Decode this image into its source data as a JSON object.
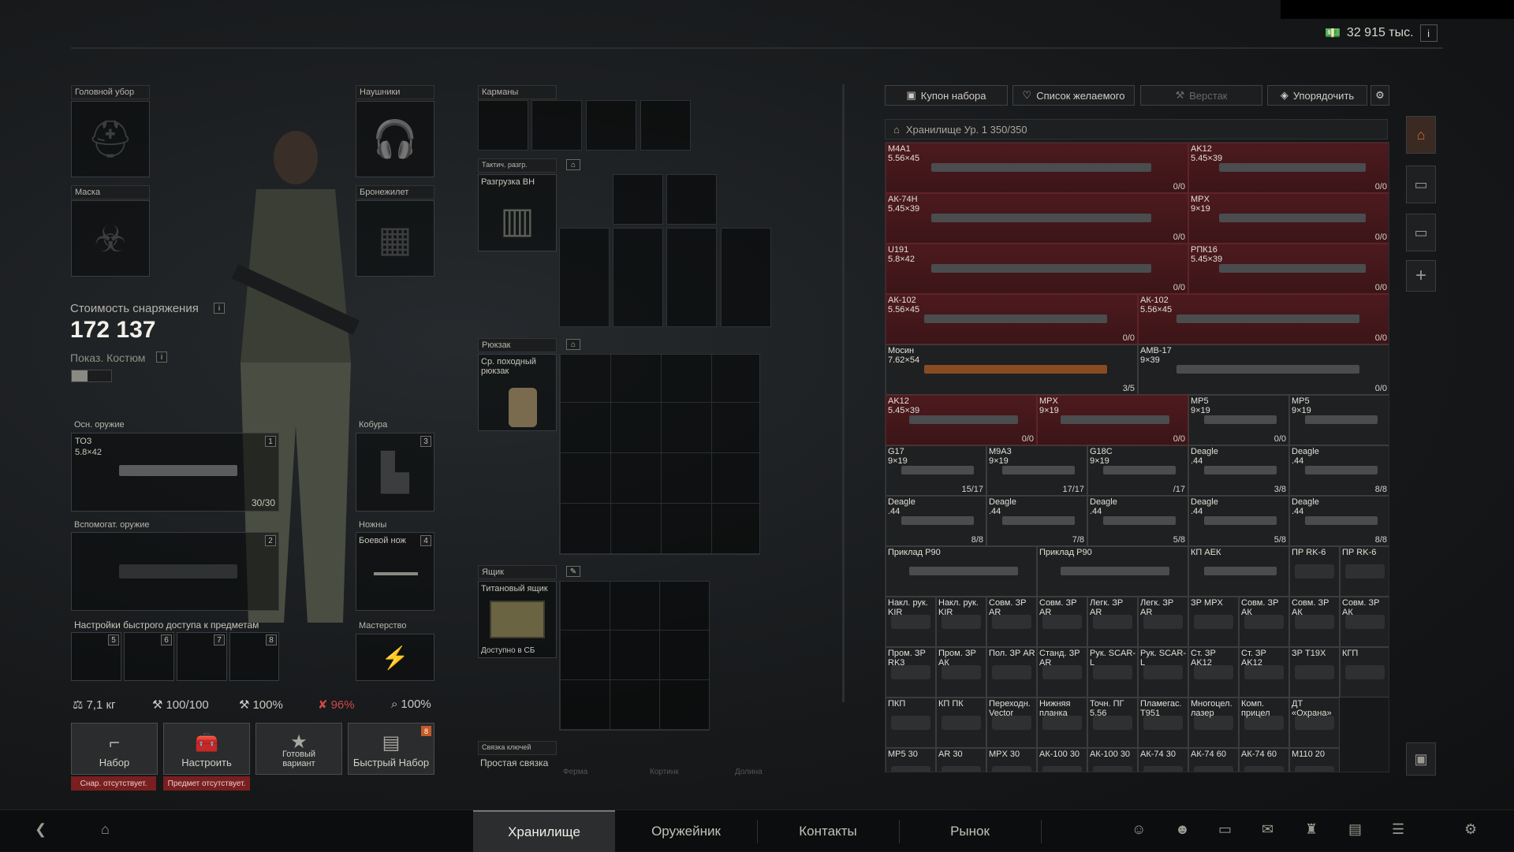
{
  "header": {
    "money": "32 915 тыс.",
    "info": "i"
  },
  "gear": {
    "headwear": "Головной убор",
    "headset": "Наушники",
    "mask": "Маска",
    "armor": "Бронежилет",
    "value_label": "Стоимость снаряжения",
    "value": "172 137",
    "costume_label": "Показ. Костюм",
    "primary": {
      "label": "Осн. оружие",
      "num": "1",
      "name": "ТОЗ",
      "caliber": "5.8×42",
      "ammo": "30/30"
    },
    "holster": {
      "label": "Кобура",
      "num": "3"
    },
    "secondary": {
      "label": "Вспомогат. оружие",
      "num": "2"
    },
    "knife": {
      "label": "Ножны",
      "num": "4",
      "name": "Боевой нож"
    },
    "quick_label": "Настройки быстрого доступа к предметам",
    "quick_nums": [
      "5",
      "6",
      "7",
      "8"
    ],
    "mastery": "Мастерство"
  },
  "stats": {
    "weight": "7,1 кг",
    "durability": "100/100",
    "s2": "100%",
    "s3": "96%",
    "s4": "100%"
  },
  "buttons": [
    {
      "label": "Набор",
      "warn": "Снар. отсутствует."
    },
    {
      "label": "Настроить",
      "warn": "Предмет отсутствует."
    },
    {
      "label": "Готовый\nвариант"
    },
    {
      "label": "Быстрый Набор",
      "badge": "8"
    }
  ],
  "containers": {
    "pockets": "Карманы",
    "rig_label": "Тактич. разгр.",
    "rig_name": "Разгрузка ВН",
    "backpack_label": "Рюкзак",
    "backpack_name": "Ср. походный рюкзак",
    "case_label": "Ящик",
    "case_name": "Титановый ящик",
    "case_note": "Доступно в СБ",
    "keys_label": "Связка ключей",
    "keys_name": "Простая связка",
    "keys_slots": [
      "Ферма",
      "Кортинк",
      "Долина"
    ]
  },
  "toolbar": {
    "kit": "Купон набора",
    "wishlist": "Список желаемого",
    "workbench": "Верстак",
    "sort": "Упорядочить"
  },
  "stash": {
    "title": "Хранилище Ур. 1 350/350",
    "items": [
      {
        "n": "M4A1\n5.56×45",
        "c": "0/0",
        "r": 1
      },
      {
        "n": "AK12\n5.45×39",
        "c": "0/0",
        "r": 1
      },
      {
        "n": "АК-74Н\n5.45×39",
        "c": "0/0",
        "r": 1
      },
      {
        "n": "MPX\n9×19",
        "c": "0/0",
        "r": 1
      },
      {
        "n": "U191\n5.8×42",
        "c": "0/0",
        "r": 1
      },
      {
        "n": "РПК16\n5.45×39",
        "c": "0/0",
        "r": 1
      },
      {
        "n": "АК-102\n5.56×45",
        "c": "0/0",
        "r": 1
      },
      {
        "n": "АК-102\n5.56×45",
        "c": "0/0",
        "r": 1
      },
      {
        "n": "Мосин\n7.62×54",
        "c": "3/5",
        "r": 0
      },
      {
        "n": "AMB-17\n9×39",
        "c": "0/0",
        "r": 0
      },
      {
        "n": "AK12\n5.45×39",
        "c": "0/0",
        "r": 1
      },
      {
        "n": "MPX\n9×19",
        "c": "0/0",
        "r": 1
      },
      {
        "n": "MP5\n9×19",
        "c": "0/0",
        "r": 0
      },
      {
        "n": "MP5\n9×19",
        "c": "",
        "r": 0
      },
      {
        "n": "G17\n9×19",
        "c": "15/17",
        "r": 0
      },
      {
        "n": "M9A3\n9×19",
        "c": "17/17",
        "r": 0
      },
      {
        "n": "G18C\n9×19",
        "c": "/17",
        "r": 0
      },
      {
        "n": "Deagle\n.44",
        "c": "3/8",
        "r": 0
      },
      {
        "n": "Deagle\n.44",
        "c": "8/8",
        "r": 0
      },
      {
        "n": "Deagle\n.44",
        "c": "8/8",
        "r": 0
      },
      {
        "n": "Deagle\n.44",
        "c": "7/8",
        "r": 0
      },
      {
        "n": "Deagle\n.44",
        "c": "5/8",
        "r": 0
      },
      {
        "n": "Deagle\n.44",
        "c": "5/8",
        "r": 0
      },
      {
        "n": "Deagle\n.44",
        "c": "8/8",
        "r": 0
      },
      {
        "n": "Приклад P90",
        "c": "",
        "r": 0
      },
      {
        "n": "Приклад P90",
        "c": "",
        "r": 0
      },
      {
        "n": "КП АЕК",
        "c": "",
        "r": 0
      },
      {
        "n": "ПР RK-6",
        "c": "",
        "r": 0
      },
      {
        "n": "ПР RK-6",
        "c": "",
        "r": 0
      },
      {
        "n": "Накл. рук.\nKIR",
        "c": "",
        "r": 0
      },
      {
        "n": "Накл. рук.\nKIR",
        "c": "",
        "r": 0
      },
      {
        "n": "Совм. ЗР\nAR",
        "c": "",
        "r": 0
      },
      {
        "n": "Совм. ЗР\nAR",
        "c": "",
        "r": 0
      },
      {
        "n": "Легк. ЗР\nAR",
        "c": "",
        "r": 0
      },
      {
        "n": "Легк. ЗР\nAR",
        "c": "",
        "r": 0
      },
      {
        "n": "ЗР MPX",
        "c": "",
        "r": 0
      },
      {
        "n": "Совм. ЗР\nАК",
        "c": "",
        "r": 0
      },
      {
        "n": "Совм. ЗР\nАК",
        "c": "",
        "r": 0
      },
      {
        "n": "Совм. ЗР\nАК",
        "c": "",
        "r": 0
      },
      {
        "n": "Пром. ЗР\nRK3",
        "c": "",
        "r": 0
      },
      {
        "n": "Пром. ЗР\nАК",
        "c": "",
        "r": 0
      },
      {
        "n": "Пол. ЗР AR",
        "c": "",
        "r": 0
      },
      {
        "n": "Станд. ЗР\nAR",
        "c": "",
        "r": 0
      },
      {
        "n": "Рук. SCAR-\nL",
        "c": "",
        "r": 0
      },
      {
        "n": "Рук. SCAR-\nL",
        "c": "",
        "r": 0
      },
      {
        "n": "Ст. ЗР\nAK12",
        "c": "",
        "r": 0
      },
      {
        "n": "Ст. ЗР\nAK12",
        "c": "",
        "r": 0
      },
      {
        "n": "ЗР T19X",
        "c": "",
        "r": 0
      },
      {
        "n": "КГП",
        "c": "",
        "r": 0
      },
      {
        "n": "ПКП",
        "c": "",
        "r": 0
      },
      {
        "n": "КП ПК",
        "c": "",
        "r": 0
      },
      {
        "n": "Переходн.\nVector",
        "c": "",
        "r": 0
      },
      {
        "n": "Нижняя\nпланка",
        "c": "",
        "r": 0
      },
      {
        "n": "Точн. ПГ\n5.56",
        "c": "",
        "r": 0
      },
      {
        "n": "Пламегас.\nT951",
        "c": "",
        "r": 0
      },
      {
        "n": "Многоцел.\nлазер",
        "c": "",
        "r": 0
      },
      {
        "n": "Комп.\nприцел",
        "c": "",
        "r": 0
      },
      {
        "n": "ДТ\n«Охрана»",
        "c": "",
        "r": 0
      },
      {
        "n": "MP5 30",
        "c": "",
        "r": 0
      },
      {
        "n": "AR 30",
        "c": "",
        "r": 0
      },
      {
        "n": "MPX 30",
        "c": "",
        "r": 0
      },
      {
        "n": "АК-100 30",
        "c": "",
        "r": 0
      },
      {
        "n": "АК-100 30",
        "c": "",
        "r": 0
      },
      {
        "n": "АК-74 30",
        "c": "",
        "r": 0
      },
      {
        "n": "АК-74 60",
        "c": "",
        "r": 0
      },
      {
        "n": "АК-74 60",
        "c": "",
        "r": 0
      },
      {
        "n": "M110 20",
        "c": "",
        "r": 0
      }
    ]
  },
  "nav": {
    "tabs": [
      "Хранилище",
      "Оружейник",
      "Контакты",
      "Рынок"
    ]
  },
  "colors": {
    "red_item": "#4d1a1e",
    "warn": "#7a1f1f"
  }
}
